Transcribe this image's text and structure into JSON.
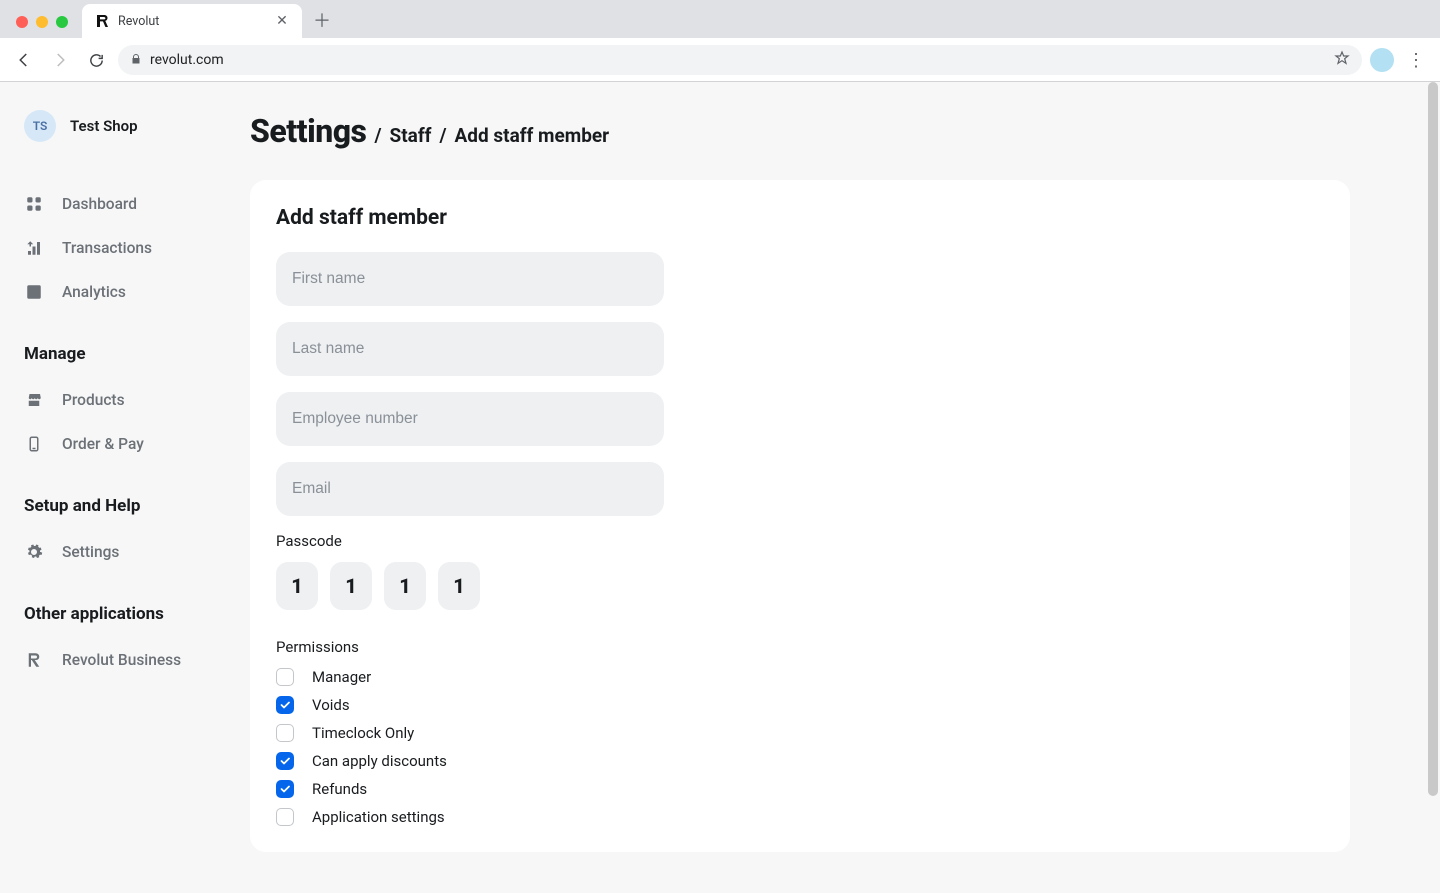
{
  "browser": {
    "tab_title": "Revolut",
    "url": "revolut.com"
  },
  "sidebar": {
    "org_initials": "TS",
    "org_name": "Test Shop",
    "primary": [
      {
        "label": "Dashboard"
      },
      {
        "label": "Transactions"
      },
      {
        "label": "Analytics"
      }
    ],
    "sections": [
      {
        "heading": "Manage",
        "items": [
          {
            "label": "Products"
          },
          {
            "label": "Order & Pay"
          }
        ]
      },
      {
        "heading": "Setup and Help",
        "items": [
          {
            "label": "Settings"
          }
        ]
      },
      {
        "heading": "Other applications",
        "items": [
          {
            "label": "Revolut Business"
          }
        ]
      }
    ]
  },
  "breadcrumb": {
    "root": "Settings",
    "path": [
      "Staff",
      "Add staff member"
    ]
  },
  "form": {
    "heading": "Add staff member",
    "fields": {
      "first_name_placeholder": "First name",
      "last_name_placeholder": "Last name",
      "employee_number_placeholder": "Employee number",
      "email_placeholder": "Email"
    },
    "passcode_label": "Passcode",
    "passcode": [
      "1",
      "1",
      "1",
      "1"
    ],
    "permissions_label": "Permissions",
    "permissions": [
      {
        "label": "Manager",
        "checked": false
      },
      {
        "label": "Voids",
        "checked": true
      },
      {
        "label": "Timeclock Only",
        "checked": false
      },
      {
        "label": "Can apply discounts",
        "checked": true
      },
      {
        "label": "Refunds",
        "checked": true
      },
      {
        "label": "Application settings",
        "checked": false
      }
    ]
  }
}
